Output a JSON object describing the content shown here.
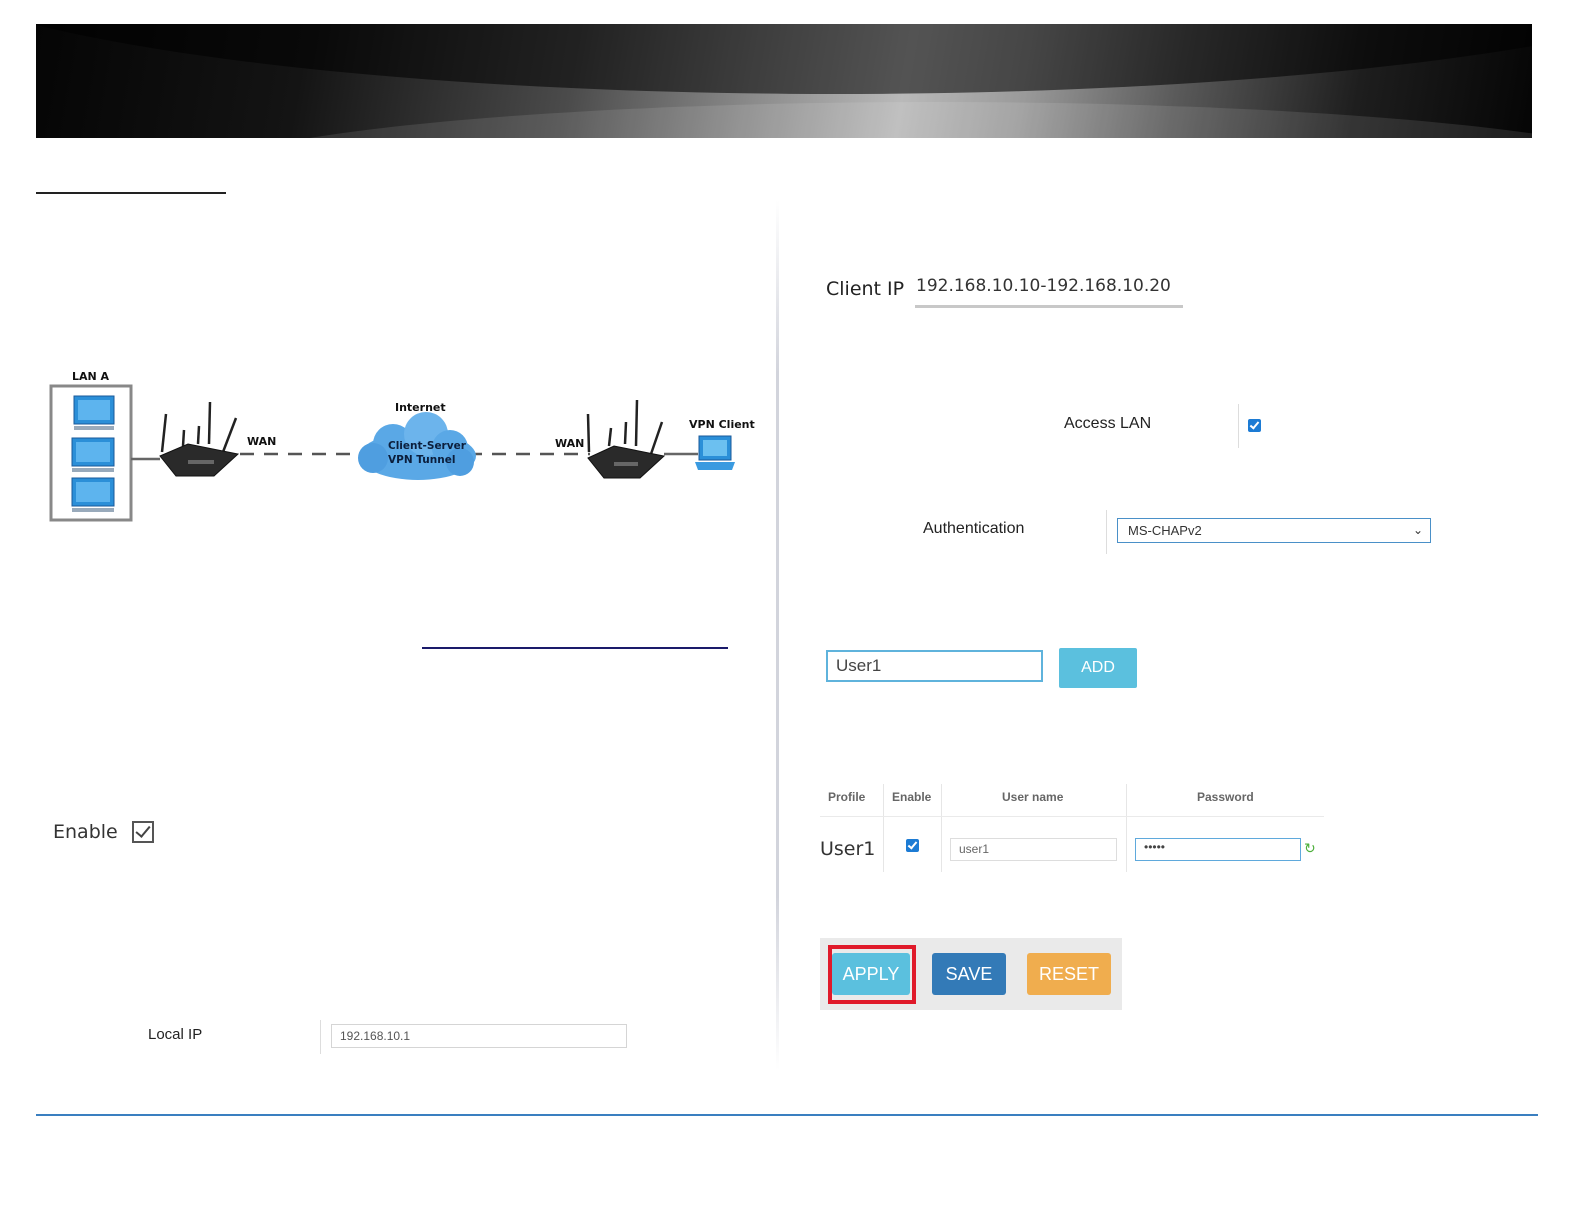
{
  "diagram": {
    "lan_label": "LAN A",
    "wan_left": "WAN",
    "internet_label": "Internet",
    "tunnel_line1": "Client-Server",
    "tunnel_line2": "VPN Tunnel",
    "wan_right": "WAN",
    "vpn_client_label": "VPN Client"
  },
  "left_form": {
    "enable_label": "Enable",
    "enable_checked": true,
    "local_ip_label": "Local IP",
    "local_ip_value": "192.168.10.1"
  },
  "right_form": {
    "client_ip_label": "Client IP",
    "client_ip_value": "192.168.10.10-192.168.10.20",
    "access_lan_label": "Access LAN",
    "access_lan_checked": true,
    "authentication_label": "Authentication",
    "authentication_value": "MS-CHAPv2",
    "new_user_value": "User1",
    "add_button": "ADD",
    "table": {
      "headers": [
        "Profile",
        "Enable",
        "User name",
        "Password"
      ],
      "rows": [
        {
          "profile": "User1",
          "enabled": true,
          "username": "user1",
          "password": "•••••"
        }
      ]
    },
    "buttons": {
      "apply": "APPLY",
      "save": "SAVE",
      "reset": "RESET"
    },
    "highlight_color": "#e01a2a"
  }
}
